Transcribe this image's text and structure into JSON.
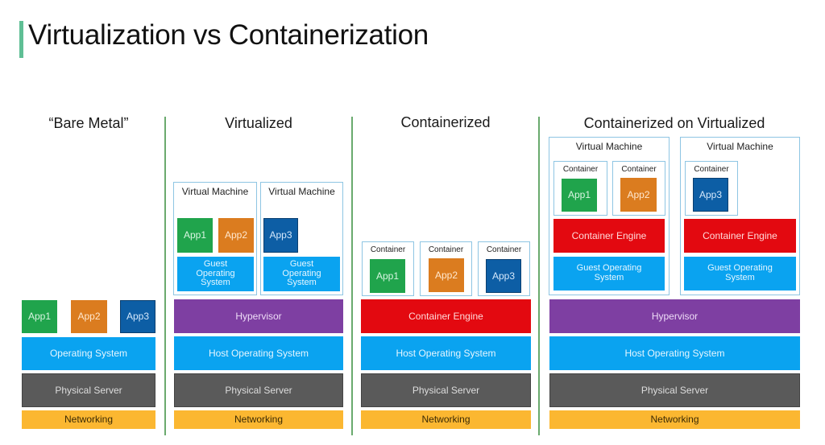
{
  "title": "Virtualization vs Containerization",
  "colors": {
    "accent": "#5fbf95",
    "os": "#0aa3f0",
    "server": "#5a5a5a",
    "networking": "#fbb731",
    "hypervisor": "#7e3fa2",
    "container_engine": "#e30910",
    "app1": "#20a44c",
    "app2": "#db7c1f",
    "app3": "#0d5ea5"
  },
  "columns": [
    {
      "heading": "“Bare Metal”",
      "apps": [
        "App1",
        "App2",
        "App3"
      ],
      "layers": [
        "Operating System",
        "Physical Server",
        "Networking"
      ]
    },
    {
      "heading": "Virtualized",
      "vms": [
        {
          "label": "Virtual Machine",
          "apps": [
            "App1",
            "App2"
          ],
          "guest_os": "Guest Operating System"
        },
        {
          "label": "Virtual Machine",
          "apps": [
            "App3"
          ],
          "guest_os": "Guest Operating System"
        }
      ],
      "layers": [
        "Hypervisor",
        "Host Operating System",
        "Physical Server",
        "Networking"
      ]
    },
    {
      "heading": "Containerized",
      "containers": [
        {
          "label": "Container",
          "app": "App1"
        },
        {
          "label": "Container",
          "app": "App2"
        },
        {
          "label": "Container",
          "app": "App3"
        }
      ],
      "layers": [
        "Container Engine",
        "Host Operating System",
        "Physical Server",
        "Networking"
      ]
    },
    {
      "heading": "Containerized on Virtualized",
      "vms": [
        {
          "label": "Virtual Machine",
          "containers": [
            {
              "label": "Container",
              "app": "App1"
            },
            {
              "label": "Container",
              "app": "App2"
            }
          ],
          "engine": "Container Engine",
          "guest_os": "Guest Operating System"
        },
        {
          "label": "Virtual Machine",
          "containers": [
            {
              "label": "Container",
              "app": "App3"
            }
          ],
          "engine": "Container Engine",
          "guest_os": "Guest Operating System"
        }
      ],
      "layers": [
        "Hypervisor",
        "Host Operating System",
        "Physical Server",
        "Networking"
      ]
    }
  ]
}
